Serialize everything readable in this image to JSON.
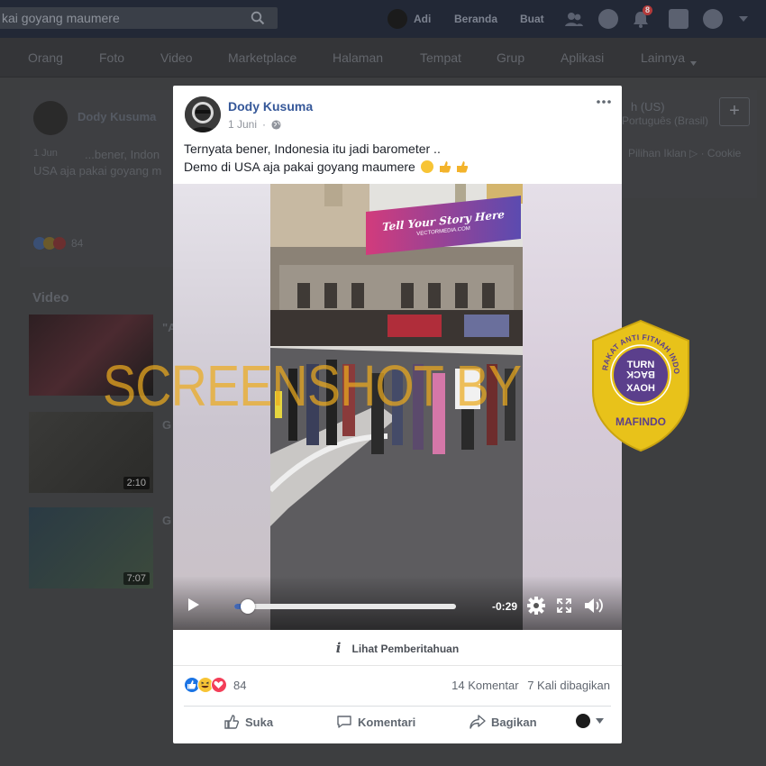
{
  "topbar": {
    "search_value": "kai goyang maumere",
    "user_name": "Adi",
    "home_label": "Beranda",
    "create_label": "Buat",
    "notif_count": "8"
  },
  "nav_tabs": [
    "Orang",
    "Foto",
    "Video",
    "Marketplace",
    "Halaman",
    "Tempat",
    "Grup",
    "Aplikasi",
    "Lainnya"
  ],
  "background": {
    "author": "Dody Kusuma",
    "date": "1 Jun",
    "text_line1": "...bener, Indon",
    "text_line2": "USA aja pakai goyang m",
    "reaction_count": "84",
    "video_section_title": "Video",
    "video_items": [
      {
        "title": "\"A",
        "duration": ""
      },
      {
        "title": "G",
        "duration": "2:10"
      },
      {
        "title": "G",
        "duration": "7:07"
      }
    ],
    "right_top": "h (US)",
    "right_lang": "Português (Brasil)",
    "right_links": "Pilihan Iklan ▷ · Cookie"
  },
  "post": {
    "author": "Dody Kusuma",
    "date": "1 Juni",
    "privacy_icon": "globe-icon",
    "text_line1": "Ternyata bener, Indonesia itu jadi barometer ..",
    "text_line2": "Demo di USA aja pakai goyang maumere",
    "video": {
      "sign_text": "Tell Your Story Here",
      "sign_sub": "VECTORMEDIA.COM",
      "time_remaining": "-0:29",
      "progress": 0.06
    },
    "notice_label": "Lihat Pemberitahuan",
    "reaction_count": "84",
    "comments": "14 Komentar",
    "shares": "7 Kali dibagikan",
    "actions": {
      "like": "Suka",
      "comment": "Komentari",
      "share": "Bagikan"
    }
  },
  "watermark": {
    "text": "SCREENSHOT BY",
    "badge_arc": "MASYARAKAT ANTI FITNAH INDONESIA",
    "badge_line1": "TURN",
    "badge_line2": "BACK",
    "badge_line3": "HOAX",
    "badge_bottom": "MAFINDO"
  },
  "colors": {
    "link_blue": "#365899",
    "accent": "#4267b2",
    "watermark": "#e9a51c",
    "badge_gold": "#e8c21a",
    "badge_purple": "#5b3f8c"
  }
}
